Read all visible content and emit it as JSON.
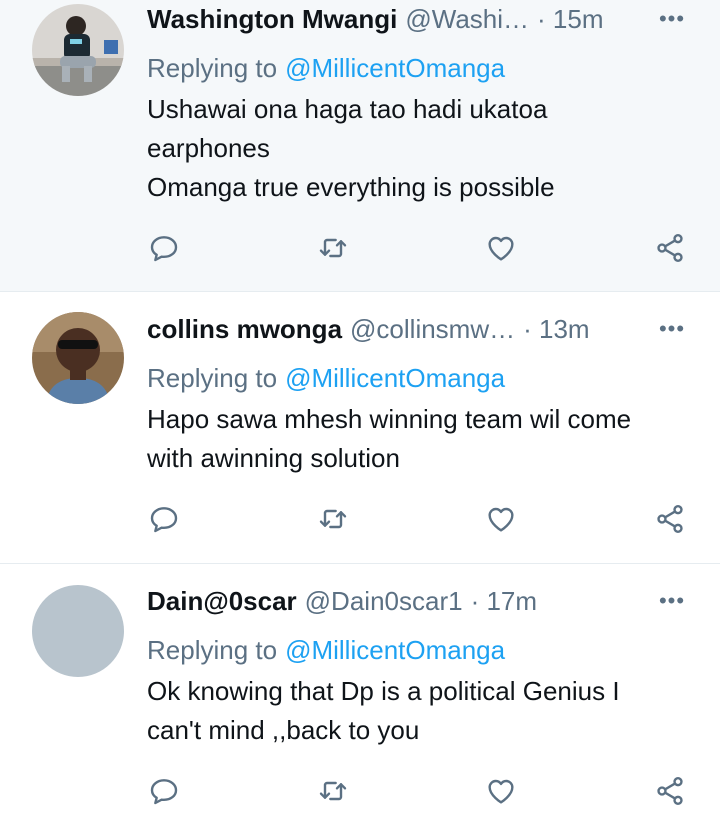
{
  "reply_prefix": "Replying to",
  "tweets": [
    {
      "name": "Washington Mwangi",
      "handle": "@Washi…",
      "time": "· 15m",
      "mention": "@MillicentOmanga",
      "lines": [
        "Ushawai ona haga tao hadi ukatoa",
        "earphones",
        "Omanga true everything is possible"
      ]
    },
    {
      "name": "collins mwonga",
      "handle": "@collinsmw…",
      "time": "· 13m",
      "mention": "@MillicentOmanga",
      "lines": [
        "Hapo sawa mhesh winning team wil come",
        "with awinning solution"
      ]
    },
    {
      "name": "Dain@0scar",
      "handle": "@Dain0scar1",
      "time": "· 17m",
      "mention": "@MillicentOmanga",
      "lines": [
        "Ok knowing that Dp is a political Genius I",
        "can't mind ,,back to you"
      ]
    }
  ],
  "colors": {
    "name": "#0f1419",
    "secondary": "#5b7083",
    "mention": "#1da1f2",
    "highlight_bg": "#f5f8fa",
    "divider": "#e6ecf0"
  },
  "icons": {
    "more": "more-horizontal-icon",
    "reply": "reply-icon",
    "retweet": "retweet-icon",
    "like": "like-icon",
    "share": "share-icon"
  }
}
